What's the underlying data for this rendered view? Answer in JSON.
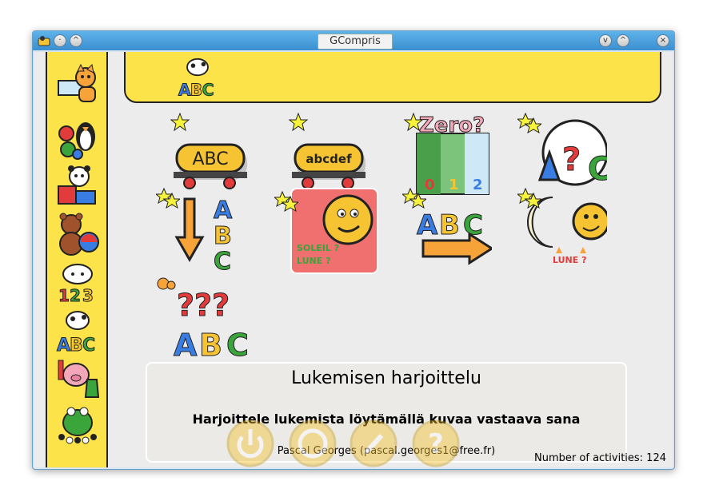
{
  "window": {
    "title": "GCompris",
    "buttons": [
      "minimize",
      "maximize",
      "close"
    ]
  },
  "sidebar": {
    "items": [
      {
        "name": "computer-activities",
        "icon": "cat-with-keyboard-icon"
      },
      {
        "name": "discovery-activities",
        "icon": "penguin-gears-icon"
      },
      {
        "name": "puzzle-activities",
        "icon": "panda-puzzle-icon"
      },
      {
        "name": "fun-activities",
        "icon": "bear-ball-icon"
      },
      {
        "name": "math-activities",
        "icon": "sheep-123-icon"
      },
      {
        "name": "reading-activities",
        "icon": "cow-abc-icon"
      },
      {
        "name": "experiment-activities",
        "icon": "pig-flask-icon"
      },
      {
        "name": "strategy-activities",
        "icon": "frog-board-icon"
      }
    ]
  },
  "category": {
    "icon": "cow-abc-icon"
  },
  "activities": [
    {
      "name": "ABC wagon",
      "icon": "abc-wagon-icon",
      "text": "ABC",
      "difficulty_stars": 1
    },
    {
      "name": "abcdef wagon",
      "icon": "abcdef-wagon-icon",
      "text": "abcdef",
      "difficulty_stars": 1
    },
    {
      "name": "Zero? counting",
      "icon": "zero-question-icon",
      "text": "Zero?",
      "difficulty_stars": 1
    },
    {
      "name": "A ? C",
      "icon": "missing-letter-icon",
      "text": "A?C",
      "difficulty_stars": 2
    },
    {
      "name": "Falling letters",
      "icon": "falling-abc-icon",
      "text": "ABC",
      "difficulty_stars": 2
    },
    {
      "name": "Soleil Lune",
      "icon": "sun-moon-word-icon",
      "text": "SOLEIL ? LUNE ?",
      "difficulty_stars": 2,
      "selected": true
    },
    {
      "name": "ABC arrow",
      "icon": "abc-arrow-icon",
      "text": "ABC",
      "difficulty_stars": 2
    },
    {
      "name": "Moon sun lune",
      "icon": "moon-sun-icon",
      "text": "LUNE ?",
      "difficulty_stars": 2
    },
    {
      "name": "??? ABC",
      "icon": "question-abc-icon",
      "text": "???",
      "difficulty_stars": 0
    }
  ],
  "info": {
    "title": "Lukemisen harjoittelu",
    "description": "Harjoittele lukemista löytämällä kuvaa vastaava sana",
    "author": "Pascal Georges (pascal.georges1@free.fr)",
    "activity_count": "Number of activities: 124"
  },
  "colors": {
    "yellow": "#fde34a",
    "selected": "#f07070",
    "panel": "#ebeae7",
    "titlebar": "#4aa0de"
  }
}
